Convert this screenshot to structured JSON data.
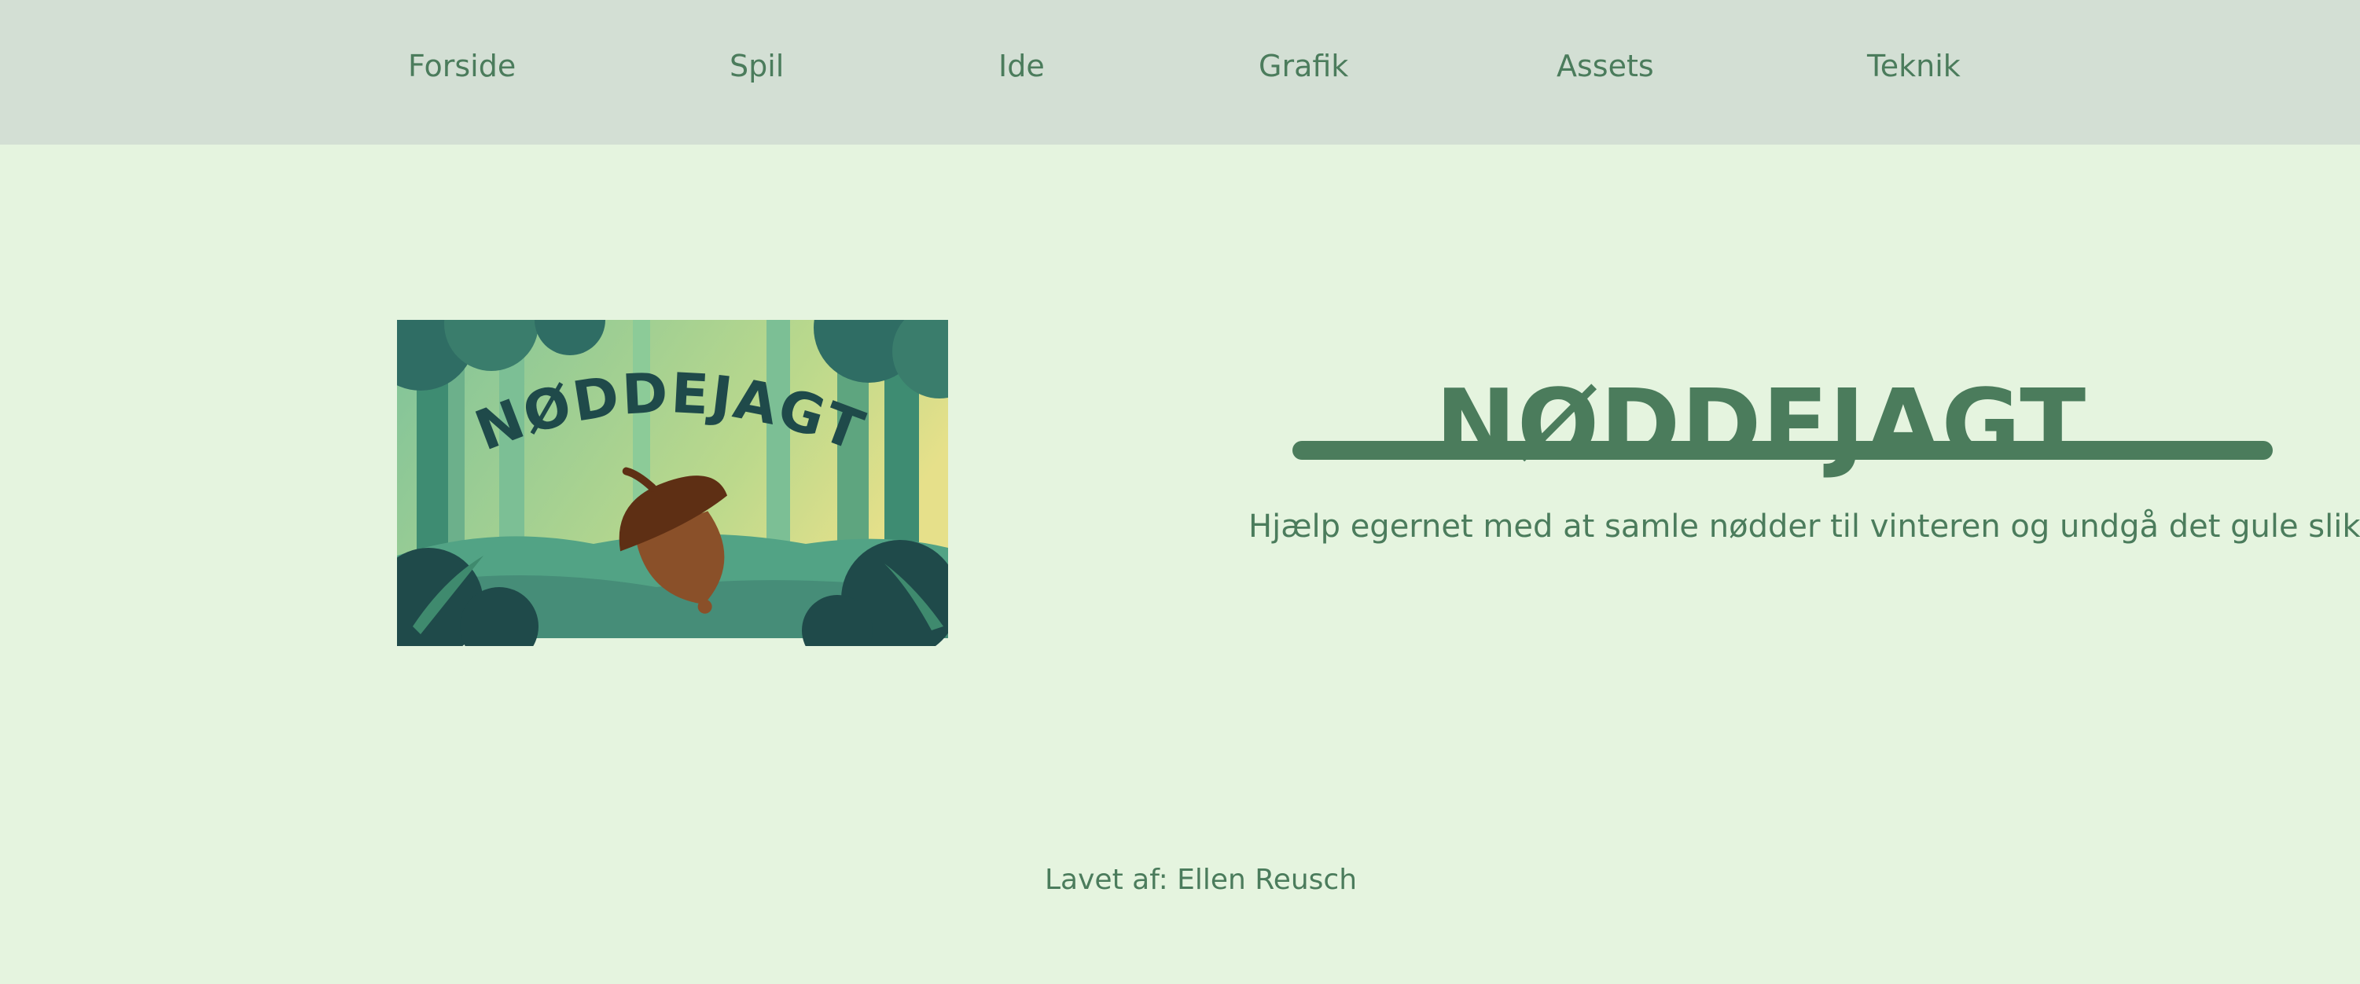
{
  "nav": {
    "items": [
      {
        "label": "Forside"
      },
      {
        "label": "Spil"
      },
      {
        "label": "Ide"
      },
      {
        "label": "Grafik"
      },
      {
        "label": "Assets"
      },
      {
        "label": "Teknik"
      }
    ]
  },
  "hero": {
    "image_icon": "acorn-forest-logo",
    "image_text": "NØDDEJAGT",
    "title": "NØDDEJAGT",
    "tagline": "Hjælp egernet med at samle nødder til vinteren og undgå det gule slik"
  },
  "footer": {
    "credit": "Lavet af: Ellen Reusch"
  },
  "colors": {
    "nav_bg": "#d3dfd4",
    "page_bg": "#e5f4df",
    "accent": "#4b7c5c",
    "acorn_cap": "#5e2f14",
    "acorn_body": "#8a5029",
    "forest_dark": "#1f4a4a"
  }
}
